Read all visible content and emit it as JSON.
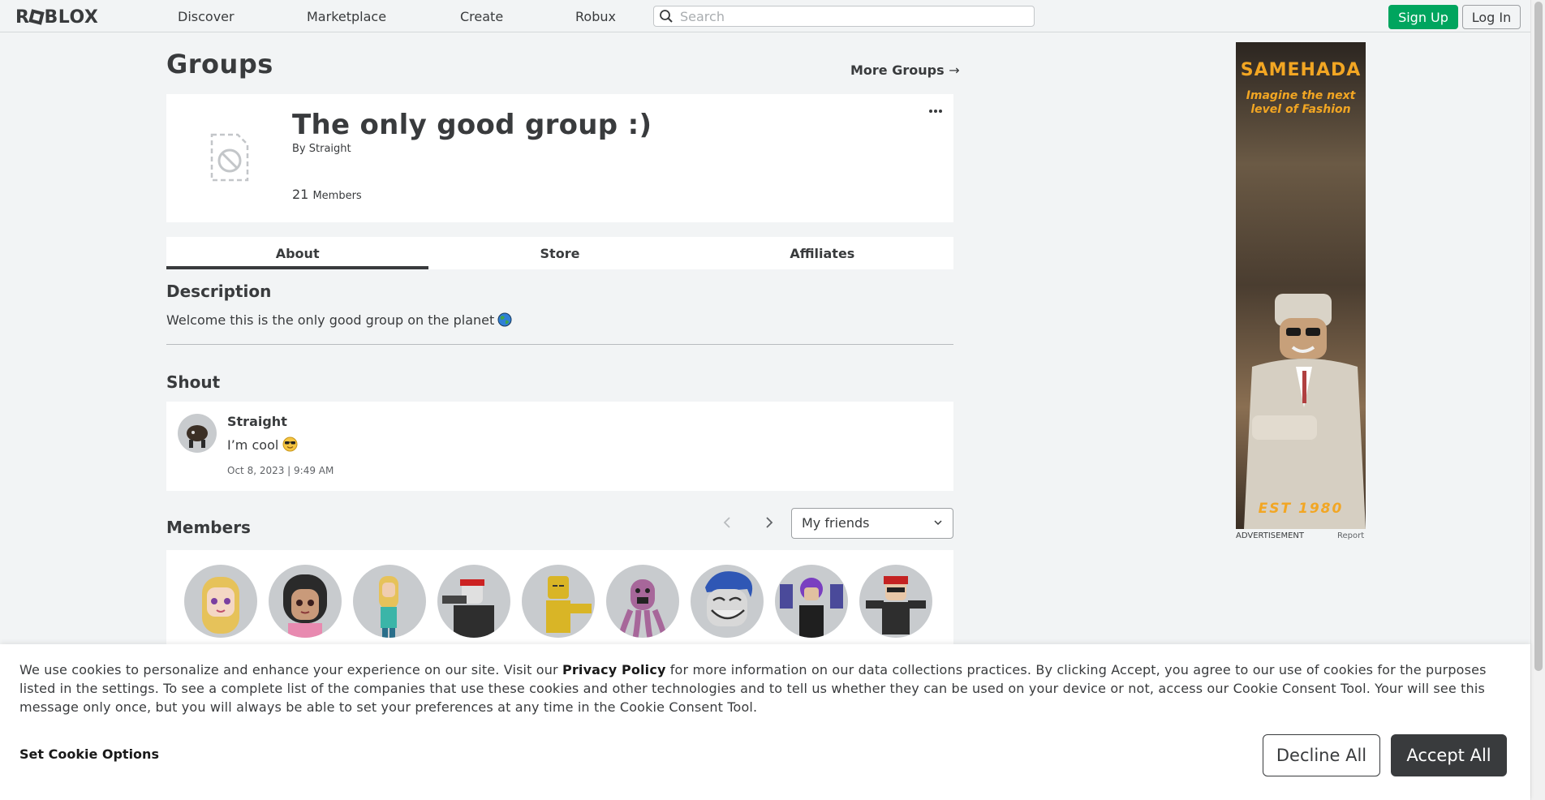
{
  "nav": {
    "logo": "ROBLOX",
    "links": [
      "Discover",
      "Marketplace",
      "Create",
      "Robux"
    ],
    "search_placeholder": "Search",
    "signup_label": "Sign Up",
    "login_label": "Log In"
  },
  "page": {
    "title": "Groups",
    "more_groups": "More Groups",
    "more_groups_arrow": "→"
  },
  "group": {
    "name": "The only good group :)",
    "by_label": "By",
    "owner": "Straight",
    "member_count": "21",
    "members_label": "Members"
  },
  "tabs": [
    "About",
    "Store",
    "Affiliates"
  ],
  "about": {
    "description_heading": "Description",
    "description": "Welcome this is the only good group on the planet",
    "shout_heading": "Shout",
    "shout": {
      "user": "Straight",
      "message": "I’m cool",
      "date": "Oct 8, 2023 | 9:49 AM"
    },
    "members_heading": "Members",
    "filter_value": "My friends",
    "member_avatars": 9
  },
  "ad": {
    "brand": "SAMEHADA",
    "tagline_1": "Imagine the next",
    "tagline_2": "level of Fashion",
    "est": "EST 1980",
    "label": "ADVERTISEMENT",
    "report": "Report"
  },
  "cookie": {
    "text_before": "We use cookies to personalize and enhance your experience on our site. Visit our ",
    "privacy_link": "Privacy Policy",
    "text_after": " for more information on our data collections practices. By clicking Accept, you agree to our use of cookies for the purposes listed in the settings. To see a complete list of the companies that use these cookies and other technologies and to tell us whether they can be used on your device or not, access our Cookie Consent Tool. Your will see this message only once, but you will always be able to set your preferences at any time in the Cookie Consent Tool.",
    "set_options": "Set Cookie Options",
    "decline": "Decline All",
    "accept": "Accept All"
  },
  "colors": {
    "accent_green": "#00a55e",
    "text_dark": "#393b3d",
    "page_bg": "#f2f4f5",
    "ad_accent": "#f2a623"
  }
}
